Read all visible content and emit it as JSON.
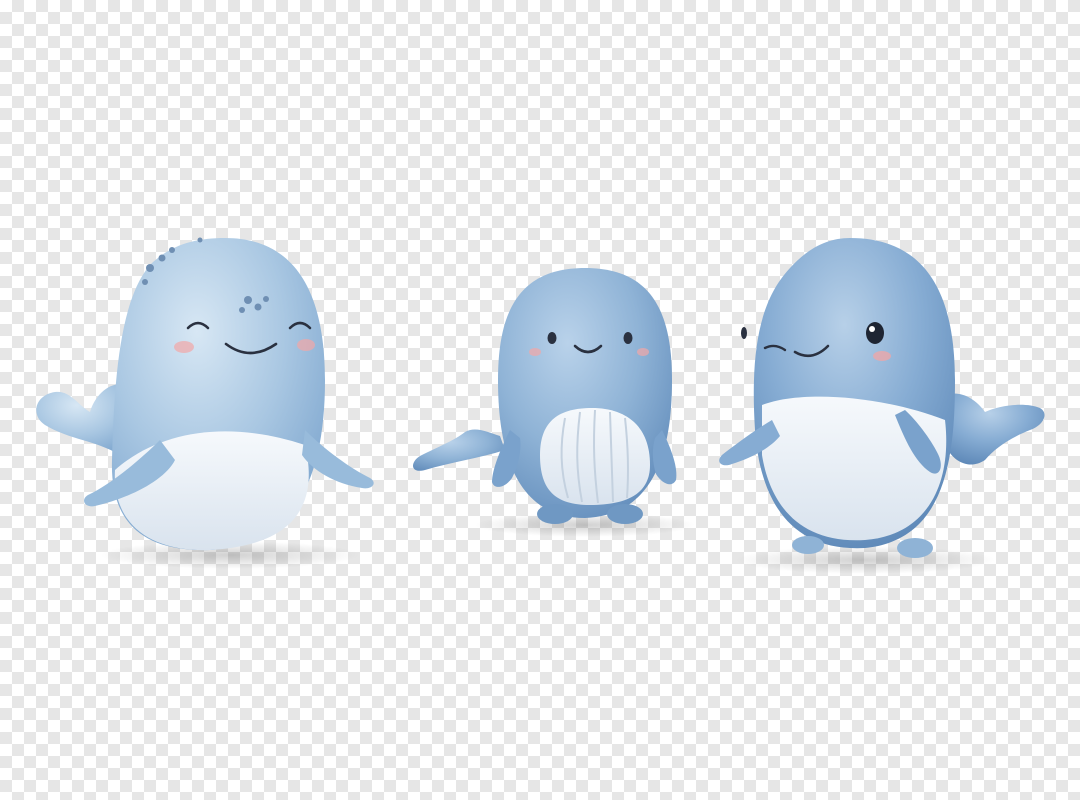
{
  "image": {
    "subject": [
      "whale-figurine",
      "whale-figurine",
      "whale-figurine"
    ],
    "background": "transparency-checkerboard",
    "colors": {
      "checker_light": "#ffffff",
      "checker_dark": "#e6e6e6",
      "whale_light": "#a9c7e2",
      "whale_mid": "#8fb3d6",
      "whale_deep": "#6f9bc6",
      "belly": "#eef2f7",
      "blush": "#f2a6a6",
      "face_line": "#2a3140"
    }
  }
}
